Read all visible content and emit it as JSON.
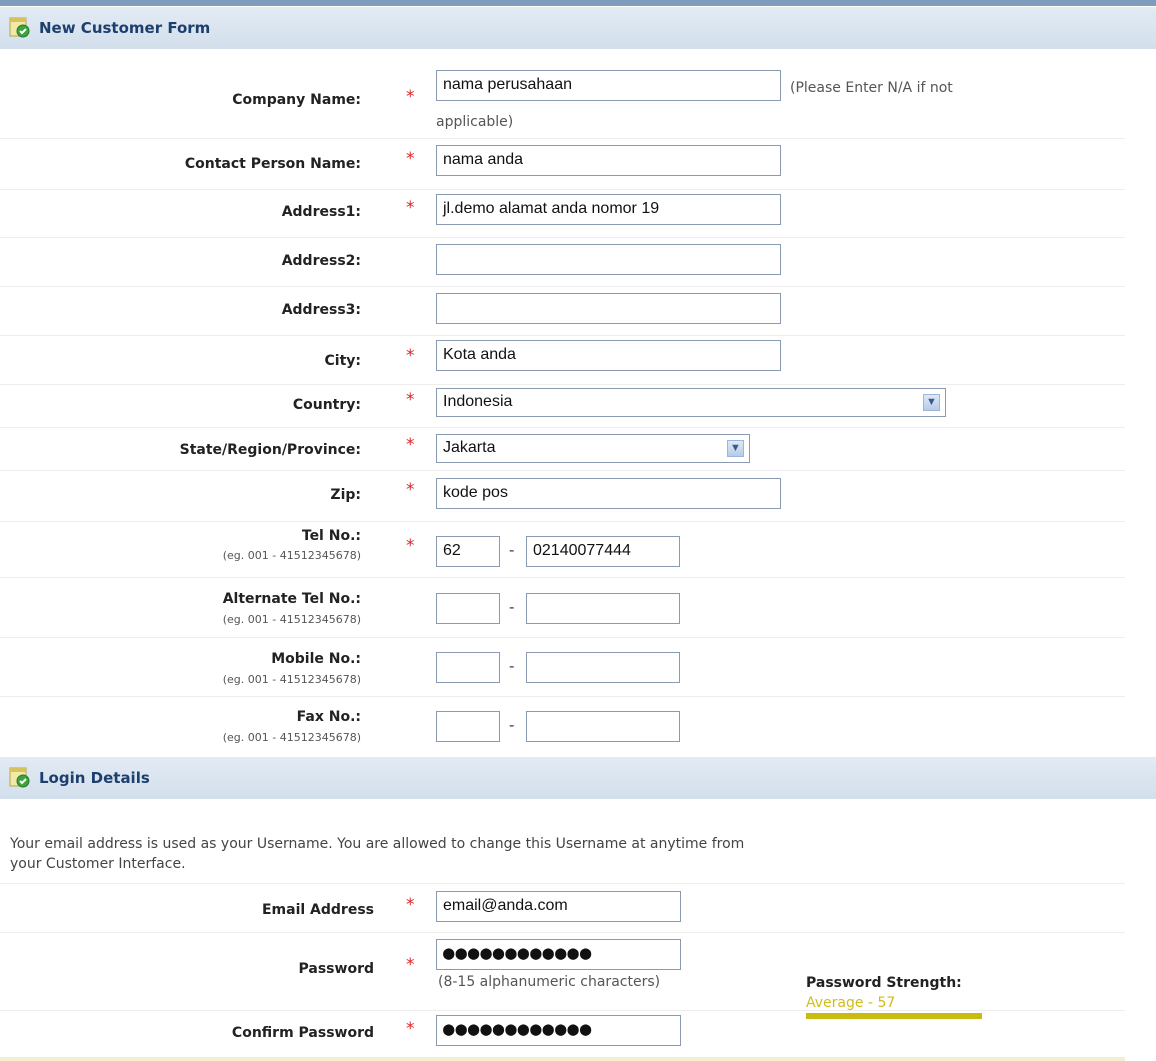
{
  "sections": {
    "customer": {
      "title": "New Customer Form",
      "icon": "form-check-icon"
    },
    "login": {
      "title": "Login Details",
      "icon": "form-check-icon"
    }
  },
  "required_mark": "*",
  "fields": {
    "company": {
      "label": "Company Name:",
      "value": "nama perusahaan",
      "hint_line1": "(Please Enter N/A if not",
      "hint_line2": "applicable)"
    },
    "contact": {
      "label": "Contact Person Name:",
      "value": "nama anda"
    },
    "address1": {
      "label": "Address1:",
      "value": "jl.demo alamat anda nomor 19"
    },
    "address2": {
      "label": "Address2:",
      "value": ""
    },
    "address3": {
      "label": "Address3:",
      "value": ""
    },
    "city": {
      "label": "City:",
      "value": "Kota anda"
    },
    "country": {
      "label": "Country:",
      "value": "Indonesia"
    },
    "state": {
      "label": "State/Region/Province:",
      "value": "Jakarta"
    },
    "zip": {
      "label": "Zip:",
      "value": "kode pos"
    },
    "tel": {
      "label": "Tel No.:",
      "example": "(eg. 001 - 41512345678)",
      "code": "62",
      "number": "02140077444"
    },
    "alt_tel": {
      "label": "Alternate Tel No.:",
      "example": "(eg. 001 - 41512345678)",
      "code": "",
      "number": ""
    },
    "mobile": {
      "label": "Mobile No.:",
      "example": "(eg. 001 - 41512345678)",
      "code": "",
      "number": ""
    },
    "fax": {
      "label": "Fax No.:",
      "example": "(eg. 001 - 41512345678)",
      "code": "",
      "number": ""
    }
  },
  "phone_separator": "-",
  "login": {
    "note_line1": "Your email address is used as your Username. You are allowed to change this Username at anytime from",
    "note_line2": "your Customer Interface.",
    "email": {
      "label": "Email Address",
      "value": "email@anda.com"
    },
    "password": {
      "label": "Password",
      "value": "●●●●●●●●●●●●",
      "hint": "(8-15 alphanumeric characters)"
    },
    "confirm": {
      "label": "Confirm Password",
      "value": "●●●●●●●●●●●●"
    },
    "strength": {
      "label": "Password Strength:",
      "value": "Average - 57",
      "score": 57,
      "color": "#d1bd14"
    }
  }
}
